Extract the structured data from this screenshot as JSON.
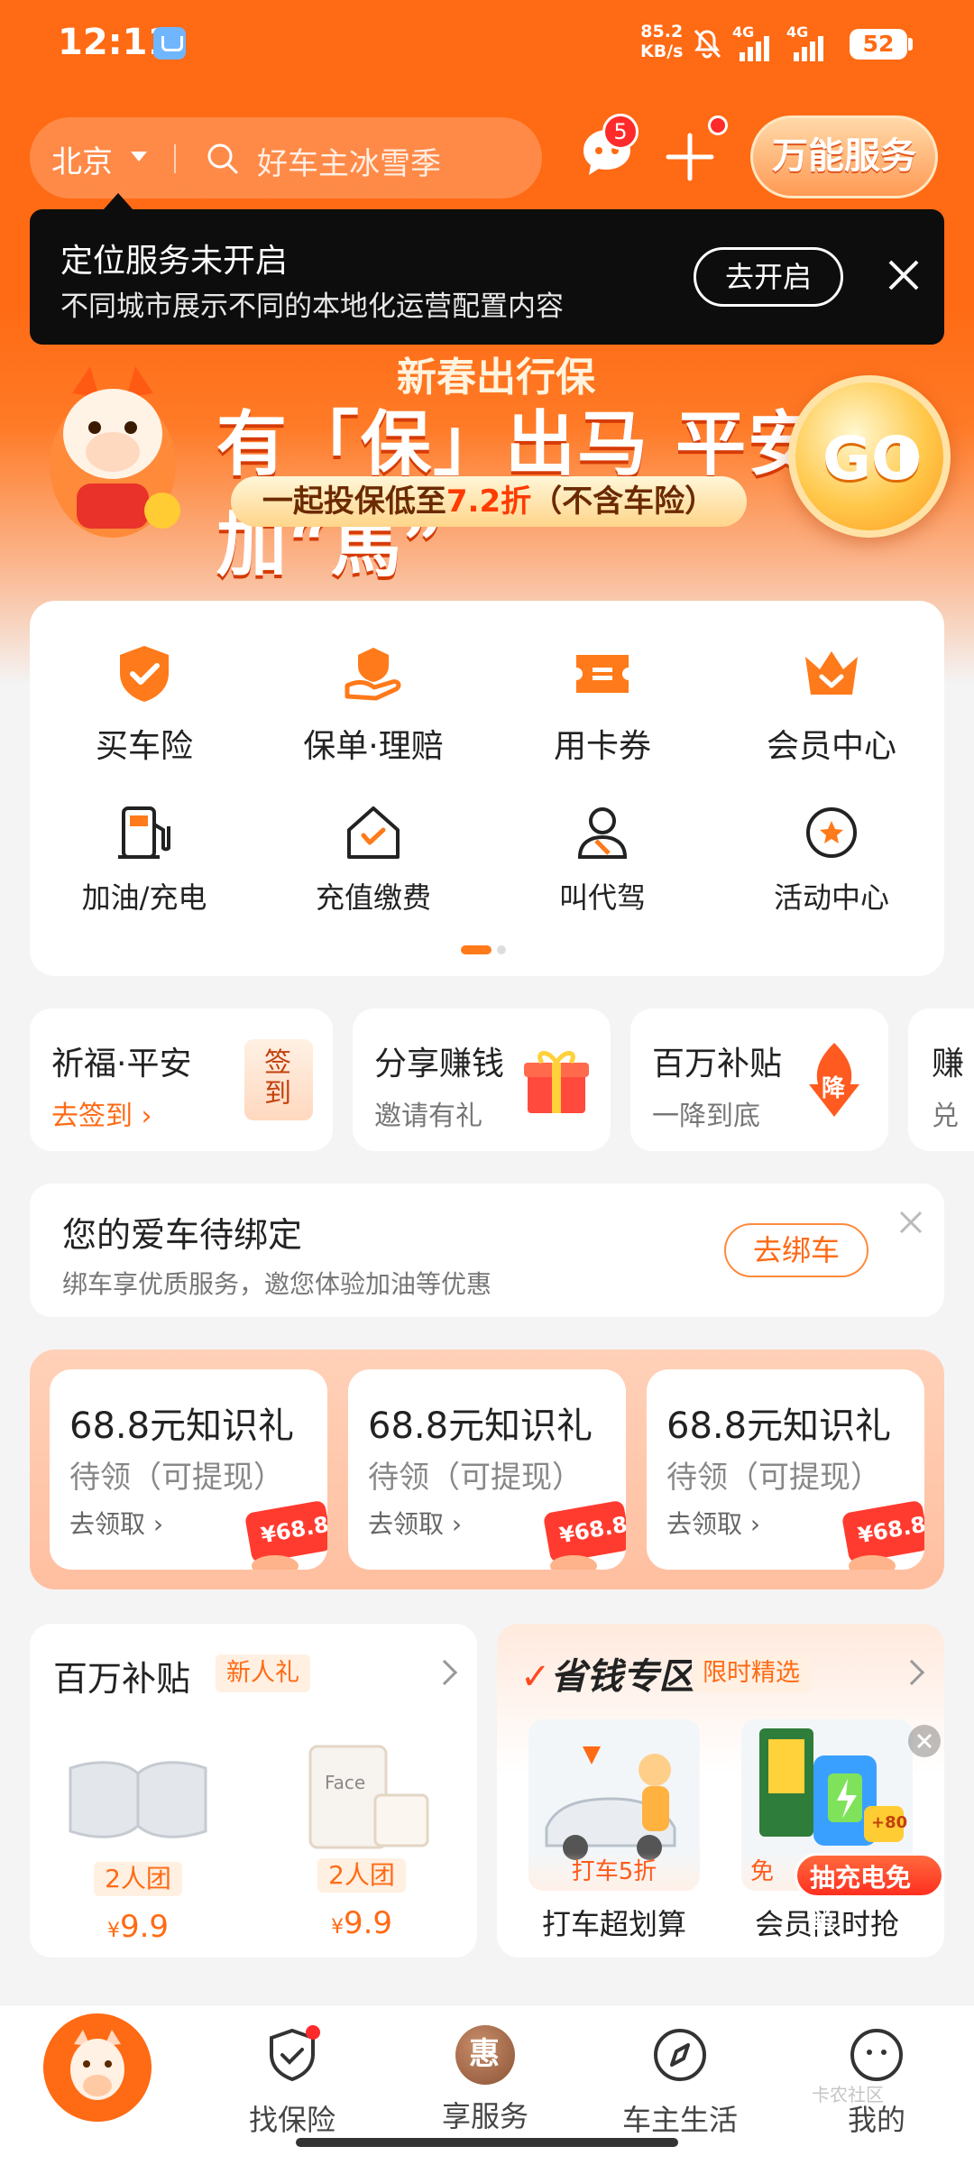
{
  "status_bar": {
    "time": "12:11",
    "net_speed_value": "85.2",
    "net_speed_unit": "KB/s",
    "signal1_label": "4G",
    "signal2_label": "4G",
    "battery": "52"
  },
  "header": {
    "city": "北京",
    "search_placeholder": "好车主冰雪季",
    "message_badge": "5",
    "service_button": "万能服务"
  },
  "location_toast": {
    "title": "定位服务未开启",
    "subtitle": "不同城市展示不同的本地化运营配置内容",
    "open_button": "去开启"
  },
  "banner": {
    "kicker": "新春出行保",
    "headline": "有「保」出马 平安加“馬”",
    "promo_prefix": "一起投保低至",
    "promo_highlight": "7.2折",
    "promo_suffix": "（不含车险）",
    "go_label": "GO"
  },
  "services": [
    {
      "label": "买车险",
      "icon": "shield-check-icon"
    },
    {
      "label": "保单·理赔",
      "icon": "hand-claim-icon"
    },
    {
      "label": "用卡券",
      "icon": "coupon-icon"
    },
    {
      "label": "会员中心",
      "icon": "crown-icon"
    },
    {
      "label": "加油/充电",
      "icon": "fuel-pump-icon"
    },
    {
      "label": "充值缴费",
      "icon": "house-payment-icon"
    },
    {
      "label": "叫代驾",
      "icon": "driver-icon"
    },
    {
      "label": "活动中心",
      "icon": "star-circle-icon"
    }
  ],
  "quick_cards": [
    {
      "title": "祈福·平安",
      "subtitle": "去签到",
      "icon": "sign-in-icon",
      "icon_text": "签到"
    },
    {
      "title": "分享赚钱",
      "subtitle": "邀请有礼",
      "icon": "gift-icon"
    },
    {
      "title": "百万补贴",
      "subtitle": "一降到底",
      "icon": "price-drop-icon",
      "icon_text": "降"
    },
    {
      "title": "赚",
      "subtitle": "兑",
      "icon": "partial-icon"
    }
  ],
  "bind_car": {
    "title": "您的爱车待绑定",
    "subtitle": "绑车享优质服务，邀您体验加油等优惠",
    "button": "去绑车"
  },
  "rewards": [
    {
      "title": "68.8元知识礼",
      "status": "待领（可提现）",
      "action": "去领取",
      "ticket": "¥68.8"
    },
    {
      "title": "68.8元知识礼",
      "status": "待领（可提现）",
      "action": "去领取",
      "ticket": "¥68.8"
    },
    {
      "title": "68.8元知识礼",
      "status": "待领（可提现）",
      "action": "去领取",
      "ticket": "¥68.8"
    }
  ],
  "subsidy_card": {
    "title": "百万补贴",
    "tag": "新人礼",
    "products": [
      {
        "tag": "2人团",
        "price": "9.9",
        "currency": "¥",
        "brand": ""
      },
      {
        "tag": "2人团",
        "price": "9.9",
        "currency": "¥",
        "brand": "Face"
      }
    ]
  },
  "savings_card": {
    "title": "省钱专区",
    "tag": "限时精选",
    "items": [
      {
        "image_text": "打车5折",
        "label": "打车超划算"
      },
      {
        "image_text": "免",
        "label": "会员限时抢",
        "sticker": "抽充电免单",
        "coupon": "+80"
      }
    ]
  },
  "tabbar": [
    {
      "label": "找保险",
      "icon": "shield-check-icon",
      "dot": true
    },
    {
      "label": "享服务",
      "icon": "hui-badge-icon",
      "icon_text": "惠"
    },
    {
      "label": "车主生活",
      "icon": "compass-icon"
    },
    {
      "label": "我的",
      "icon": "smiley-icon"
    }
  ],
  "watermark": "卡农社区",
  "colors": {
    "brand": "#ff6a14",
    "badge": "#ff2a2a",
    "toast_bg": "#0d0d0d"
  }
}
